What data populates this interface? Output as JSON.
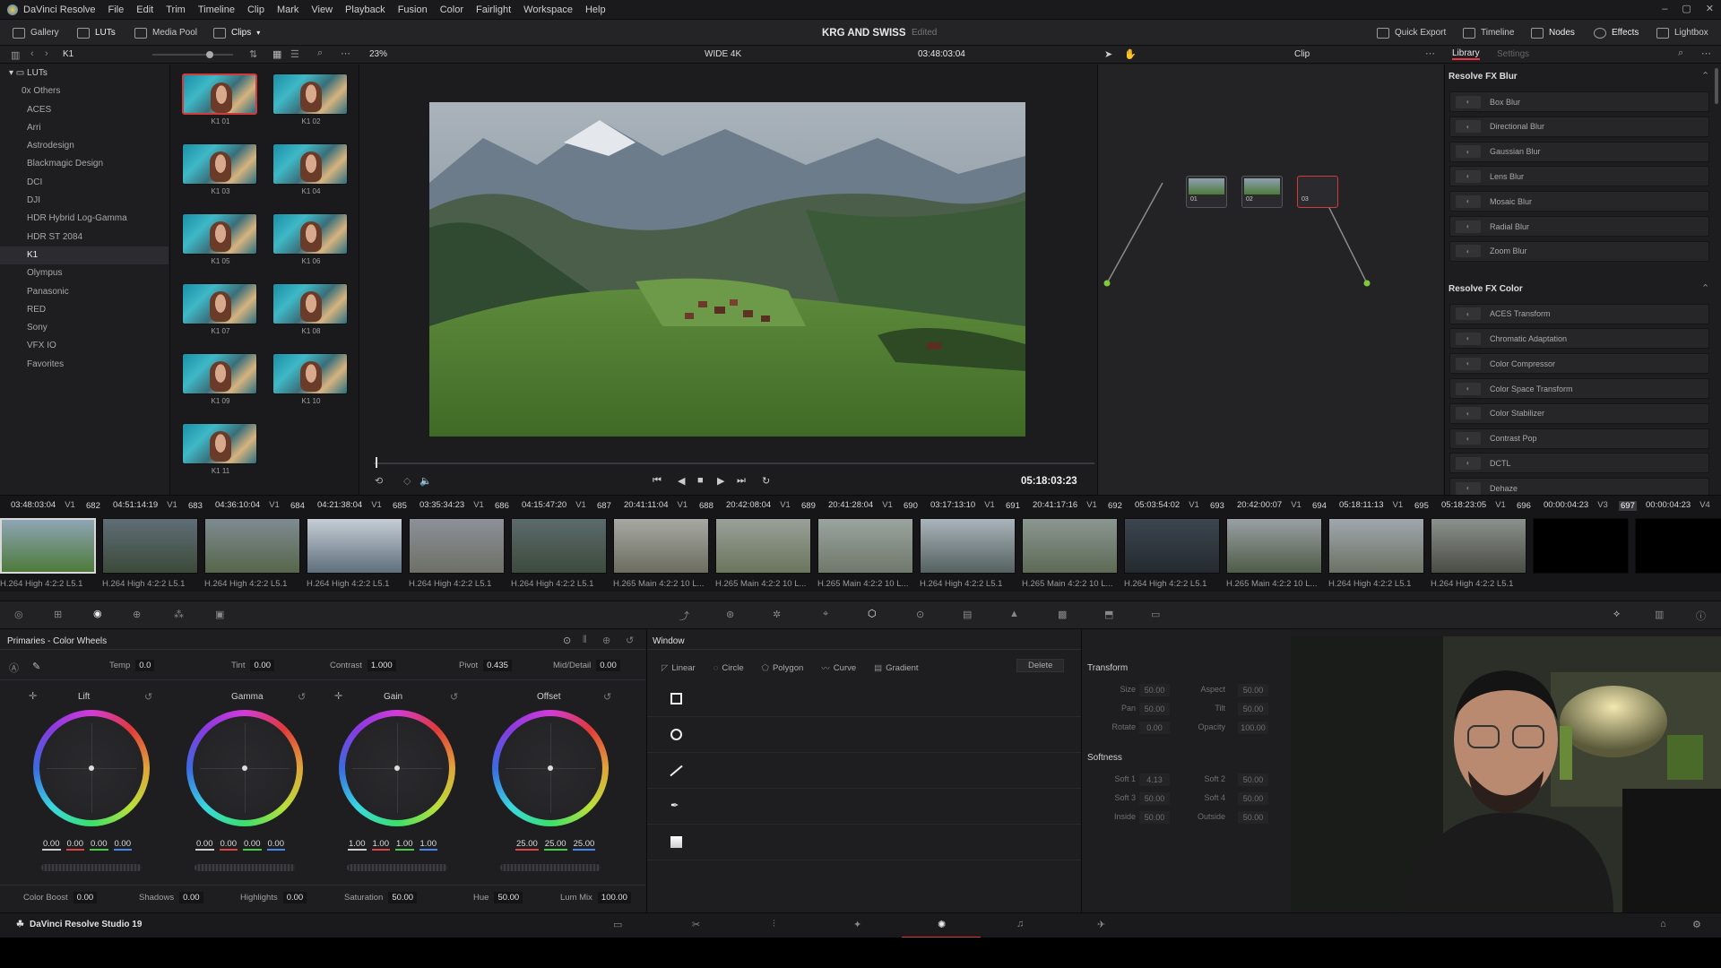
{
  "menubar": {
    "app_name": "DaVinci Resolve",
    "items": [
      "File",
      "Edit",
      "Trim",
      "Timeline",
      "Clip",
      "Mark",
      "View",
      "Playback",
      "Fusion",
      "Color",
      "Fairlight",
      "Workspace",
      "Help"
    ]
  },
  "toolbar": {
    "gallery": "Gallery",
    "luts": "LUTs",
    "media_pool": "Media Pool",
    "clips": "Clips",
    "project_title": "KRG AND SWISS",
    "project_status": "Edited",
    "quick_export": "Quick Export",
    "timeline": "Timeline",
    "nodes": "Nodes",
    "effects": "Effects",
    "lightbox": "Lightbox"
  },
  "viewer_header": {
    "folder": "K1",
    "zoom": "23%",
    "timeline_name": "WIDE 4K",
    "timecode": "03:48:03:04",
    "clip_mode": "Clip",
    "library_tab": "Library",
    "settings_tab": "Settings"
  },
  "lut_folders": {
    "root": "LUTs",
    "items": [
      "0x Others",
      "ACES",
      "Arri",
      "Astrodesign",
      "Blackmagic Design",
      "DCI",
      "DJI",
      "HDR Hybrid Log-Gamma",
      "HDR ST 2084",
      "K1",
      "Olympus",
      "Panasonic",
      "RED",
      "Sony",
      "VFX IO",
      "Favorites"
    ],
    "selected": "K1"
  },
  "lut_thumbs": [
    "K1 01",
    "K1 02",
    "K1 03",
    "K1 04",
    "K1 05",
    "K1 06",
    "K1 07",
    "K1 08",
    "K1 09",
    "K1 10",
    "K1 11"
  ],
  "viewer": {
    "playhead_timecode": "05:18:03:23"
  },
  "nodes": [
    {
      "label": "01"
    },
    {
      "label": "02"
    },
    {
      "label": "03"
    }
  ],
  "library": {
    "sections": [
      {
        "title": "Resolve FX Blur",
        "items": [
          "Box Blur",
          "Directional Blur",
          "Gaussian Blur",
          "Lens Blur",
          "Mosaic Blur",
          "Radial Blur",
          "Zoom Blur"
        ]
      },
      {
        "title": "Resolve FX Color",
        "items": [
          "ACES Transform",
          "Chromatic Adaptation",
          "Color Compressor",
          "Color Space Transform",
          "Color Stabilizer",
          "Contrast Pop",
          "DCTL",
          "Dehaze"
        ]
      }
    ]
  },
  "clips": [
    {
      "tc": "03:48:03:04",
      "track": "V1",
      "num": "682",
      "codec": "H.264 High 4:2:2 L5.1"
    },
    {
      "tc": "04:51:14:19",
      "track": "V1",
      "num": "683",
      "codec": "H.264 High 4:2:2 L5.1"
    },
    {
      "tc": "04:36:10:04",
      "track": "V1",
      "num": "684",
      "codec": "H.264 High 4:2:2 L5.1"
    },
    {
      "tc": "04:21:38:04",
      "track": "V1",
      "num": "685",
      "codec": "H.264 High 4:2:2 L5.1"
    },
    {
      "tc": "03:35:34:23",
      "track": "V1",
      "num": "686",
      "codec": "H.264 High 4:2:2 L5.1"
    },
    {
      "tc": "04:15:47:20",
      "track": "V1",
      "num": "687",
      "codec": "H.264 High 4:2:2 L5.1"
    },
    {
      "tc": "20:41:11:04",
      "track": "V1",
      "num": "688",
      "codec": "H.265 Main 4:2:2 10 L..."
    },
    {
      "tc": "20:42:08:04",
      "track": "V1",
      "num": "689",
      "codec": "H.265 Main 4:2:2 10 L..."
    },
    {
      "tc": "20:41:28:04",
      "track": "V1",
      "num": "690",
      "codec": "H.265 Main 4:2:2 10 L..."
    },
    {
      "tc": "03:17:13:10",
      "track": "V1",
      "num": "691",
      "codec": "H.264 High 4:2:2 L5.1"
    },
    {
      "tc": "20:41:17:16",
      "track": "V1",
      "num": "692",
      "codec": "H.265 Main 4:2:2 10 L..."
    },
    {
      "tc": "05:03:54:02",
      "track": "V1",
      "num": "693",
      "codec": "H.264 High 4:2:2 L5.1"
    },
    {
      "tc": "20:42:00:07",
      "track": "V1",
      "num": "694",
      "codec": "H.265 Main 4:2:2 10 L..."
    },
    {
      "tc": "05:18:11:13",
      "track": "V1",
      "num": "695",
      "codec": "H.264 High 4:2:2 L5.1"
    },
    {
      "tc": "05:18:23:05",
      "track": "V1",
      "num": "696",
      "codec": "H.264 High 4:2:2 L5.1"
    },
    {
      "tc": "00:00:04:23",
      "track": "V3",
      "num": "697",
      "codec": ""
    },
    {
      "tc": "00:00:04:23",
      "track": "V4",
      "num": "",
      "codec": ""
    }
  ],
  "primaries": {
    "title": "Primaries - Color Wheels",
    "temp_label": "Temp",
    "temp": "0.0",
    "tint_label": "Tint",
    "tint": "0.00",
    "contrast_label": "Contrast",
    "contrast": "1.000",
    "pivot_label": "Pivot",
    "pivot": "0.435",
    "middetail_label": "Mid/Detail",
    "middetail": "0.00",
    "wheels": [
      {
        "name": "Lift",
        "values": [
          "0.00",
          "0.00",
          "0.00",
          "0.00"
        ]
      },
      {
        "name": "Gamma",
        "values": [
          "0.00",
          "0.00",
          "0.00",
          "0.00"
        ]
      },
      {
        "name": "Gain",
        "values": [
          "1.00",
          "1.00",
          "1.00",
          "1.00"
        ]
      },
      {
        "name": "Offset",
        "values": [
          "25.00",
          "25.00",
          "25.00"
        ]
      }
    ],
    "colorboost_label": "Color Boost",
    "colorboost": "0.00",
    "shadows_label": "Shadows",
    "shadows": "0.00",
    "highlights_label": "Highlights",
    "highlights": "0.00",
    "saturation_label": "Saturation",
    "saturation": "50.00",
    "hue_label": "Hue",
    "hue": "50.00",
    "lummix_label": "Lum Mix",
    "lummix": "100.00"
  },
  "window_panel": {
    "title": "Window",
    "tools": [
      "Linear",
      "Circle",
      "Polygon",
      "Curve",
      "Gradient"
    ],
    "delete": "Delete"
  },
  "transform_panel": {
    "title": "Transform",
    "fields": [
      {
        "l": "Size",
        "v": "50.00"
      },
      {
        "l": "Aspect",
        "v": "50.00"
      },
      {
        "l": "Pan",
        "v": "50.00"
      },
      {
        "l": "Tilt",
        "v": "50.00"
      },
      {
        "l": "Rotate",
        "v": "0.00"
      },
      {
        "l": "Opacity",
        "v": "100.00"
      }
    ],
    "softness_title": "Softness",
    "soft": [
      {
        "l": "Soft 1",
        "v": "4.13"
      },
      {
        "l": "Soft 2",
        "v": "50.00"
      },
      {
        "l": "Soft 3",
        "v": "50.00"
      },
      {
        "l": "Soft 4",
        "v": "50.00"
      },
      {
        "l": "Inside",
        "v": "50.00"
      },
      {
        "l": "Outside",
        "v": "50.00"
      }
    ]
  },
  "footer": {
    "app_version": "DaVinci Resolve Studio 19"
  }
}
